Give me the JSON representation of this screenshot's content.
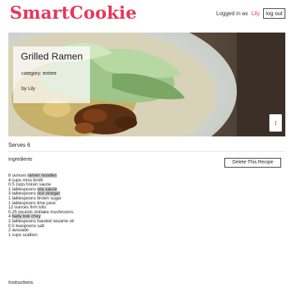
{
  "header": {
    "logo": "SmartCookie",
    "logged_in_prefix": "Logged in as",
    "username": "Lily",
    "logout_label": "log out"
  },
  "recipe": {
    "title": "Grilled Ramen",
    "category": "category: entree",
    "author": "by Lily",
    "sort_icon": "↕",
    "serves": "Serves 6",
    "ingredients_heading": "Ingredients",
    "delete_label": "Delete This Recipe",
    "ingredients": [
      {
        "pre": "8 ounces ",
        "hl": "ramen noodles"
      },
      {
        "pre": "4 cups miso broth",
        "hl": ""
      },
      {
        "pre": "0.5 cups hoisin sauce",
        "hl": ""
      },
      {
        "pre": "1 tablespoons ",
        "hl": "soy sauce"
      },
      {
        "pre": "3 tablespoons ",
        "hl": "rice vinegar"
      },
      {
        "pre": "1 tablespoons brown sugar",
        "hl": ""
      },
      {
        "pre": "1 tablespoons lime juice",
        "hl": ""
      },
      {
        "pre": "12 ounces firm tofu",
        "hl": ""
      },
      {
        "pre": "0.25 pounds shiitake mushrooms",
        "hl": ""
      },
      {
        "pre": "4 ",
        "hl": "baby bok choy"
      },
      {
        "pre": "2 tablespoons toasted sesame oil",
        "hl": ""
      },
      {
        "pre": "0.5 teaspoons salt",
        "hl": ""
      },
      {
        "pre": "2 avocado",
        "hl": ""
      },
      {
        "pre": "1 cups scallion",
        "hl": ""
      }
    ],
    "instructions_heading": "Instructions"
  },
  "colors": {
    "brand": "#e8365a",
    "highlight": "#d6d6d6"
  }
}
